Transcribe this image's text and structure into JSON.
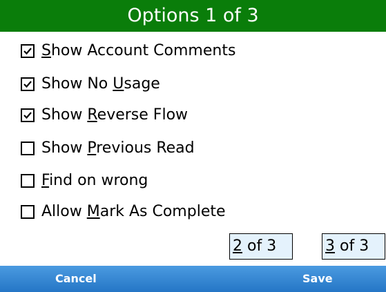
{
  "title": "Options 1 of 3",
  "options": [
    {
      "pre": "",
      "key": "S",
      "post": "how Account Comments",
      "checked": true
    },
    {
      "pre": "Show No ",
      "key": "U",
      "post": "sage",
      "checked": true
    },
    {
      "pre": "Show ",
      "key": "R",
      "post": "everse Flow",
      "checked": true
    },
    {
      "pre": "Show ",
      "key": "P",
      "post": "revious Read",
      "checked": false
    },
    {
      "pre": "",
      "key": "F",
      "post": "ind on wrong",
      "checked": false
    },
    {
      "pre": "Allow ",
      "key": "M",
      "post": "ark As Complete",
      "checked": false
    }
  ],
  "page_buttons": [
    {
      "key": "2",
      "post": " of 3"
    },
    {
      "key": "3",
      "post": " of 3"
    }
  ],
  "softkeys": {
    "left": "Cancel",
    "right": "Save"
  },
  "colors": {
    "title_bar": "#0a7d0a",
    "softkey_bar": "#2f82d2",
    "page_button_bg": "#e4f2fc"
  }
}
